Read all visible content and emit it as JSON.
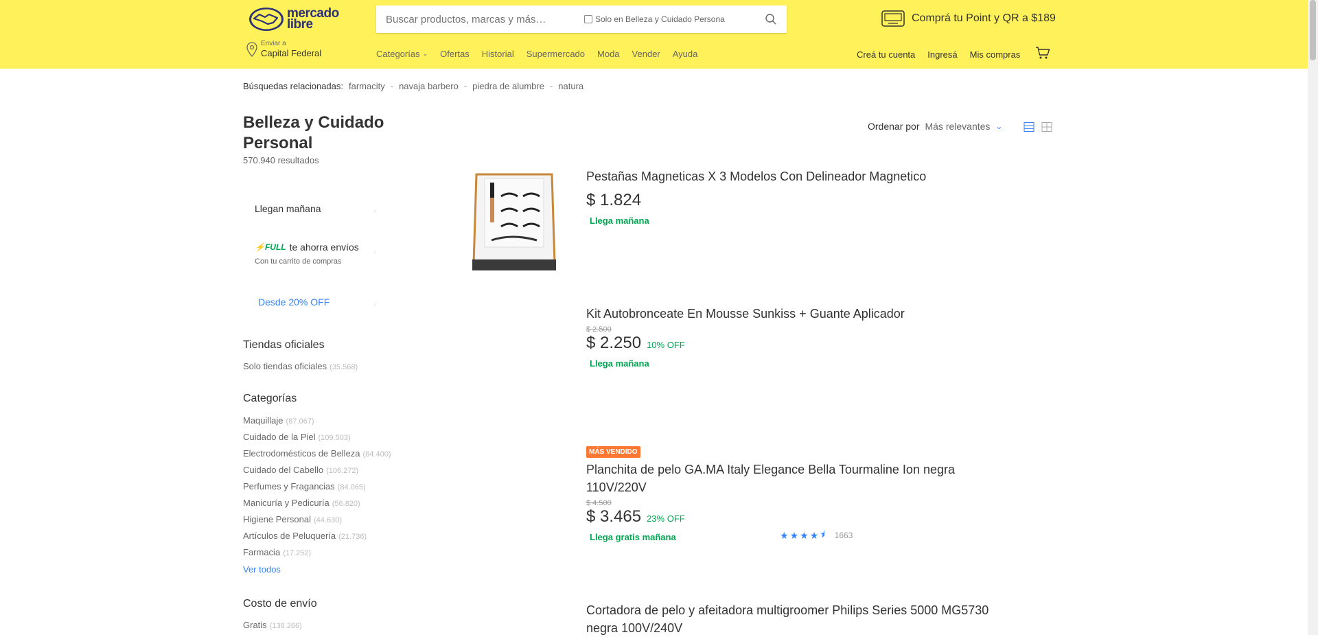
{
  "header": {
    "logo_text_line1": "mercado",
    "logo_text_line2": "libre",
    "search_placeholder": "Buscar productos, marcas y más…",
    "search_scope": "Solo en Belleza y Cuidado Persona",
    "promo": "Comprá tu Point y QR a $189",
    "location_label": "Enviar a",
    "location_city": "Capital Federal",
    "nav": [
      "Categorías",
      "Ofertas",
      "Historial",
      "Supermercado",
      "Moda",
      "Vender",
      "Ayuda"
    ],
    "user_nav": [
      "Creá tu cuenta",
      "Ingresá",
      "Mis compras"
    ]
  },
  "related": {
    "label": "Búsquedas relacionadas:",
    "items": [
      "farmacity",
      "navaja barbero",
      "piedra de alumbre",
      "natura"
    ]
  },
  "sidebar": {
    "title": "Belleza y Cuidado Personal",
    "results": "570.940 resultados",
    "llegan_manana": "Llegan mañana",
    "full_label": "FULL",
    "full_text": "te ahorra envíos",
    "full_sub": "Con tu carrito de compras",
    "desde_off": "Desde 20% OFF",
    "tiendas_title": "Tiendas oficiales",
    "tiendas_item": "Solo tiendas oficiales",
    "tiendas_count": "(35.568)",
    "categorias_title": "Categorías",
    "categorias": [
      {
        "name": "Maquillaje",
        "count": "(87.067)"
      },
      {
        "name": "Cuidado de la Piel",
        "count": "(109.503)"
      },
      {
        "name": "Electrodomésticos de Belleza",
        "count": "(84.400)"
      },
      {
        "name": "Cuidado del Cabello",
        "count": "(106.272)"
      },
      {
        "name": "Perfumes y Fragancias",
        "count": "(84.065)"
      },
      {
        "name": "Manicuría y Pedicuría",
        "count": "(56.820)"
      },
      {
        "name": "Higiene Personal",
        "count": "(44.630)"
      },
      {
        "name": "Artículos de Peluquería",
        "count": "(21.736)"
      },
      {
        "name": "Farmacia",
        "count": "(17.252)"
      }
    ],
    "ver_todos": "Ver todos",
    "envio_title": "Costo de envío",
    "envio_item": "Gratis",
    "envio_count": "(138.266)"
  },
  "sort": {
    "label": "Ordenar por",
    "value": "Más relevantes"
  },
  "products": [
    {
      "title": "Pestañas Magneticas X 3 Modelos Con Delineador Magnetico",
      "price": "$ 1.824",
      "shipping": "Llega mañana"
    },
    {
      "title": "Kit Autobronceate En Mousse Sunkiss + Guante Aplicador",
      "old_price": "$ 2.500",
      "price": "$ 2.250",
      "off": "10% OFF",
      "shipping": "Llega mañana"
    },
    {
      "badge": "MÁS VENDIDO",
      "title": "Planchita de pelo GA.MA Italy Elegance Bella Tourmaline Ion negra 110V/220V",
      "old_price": "$ 4.500",
      "price": "$ 3.465",
      "off": "23% OFF",
      "rating": 4.5,
      "reviews": "1663",
      "shipping": "Llega gratis mañana"
    },
    {
      "title": "Cortadora de pelo y afeitadora multigroomer Philips Series 5000 MG5730 negra 100V/240V"
    }
  ],
  "colors": {
    "header_bg": "#fff159",
    "accent_blue": "#3483fa",
    "green": "#00a650",
    "badge_orange": "#ff7733"
  }
}
